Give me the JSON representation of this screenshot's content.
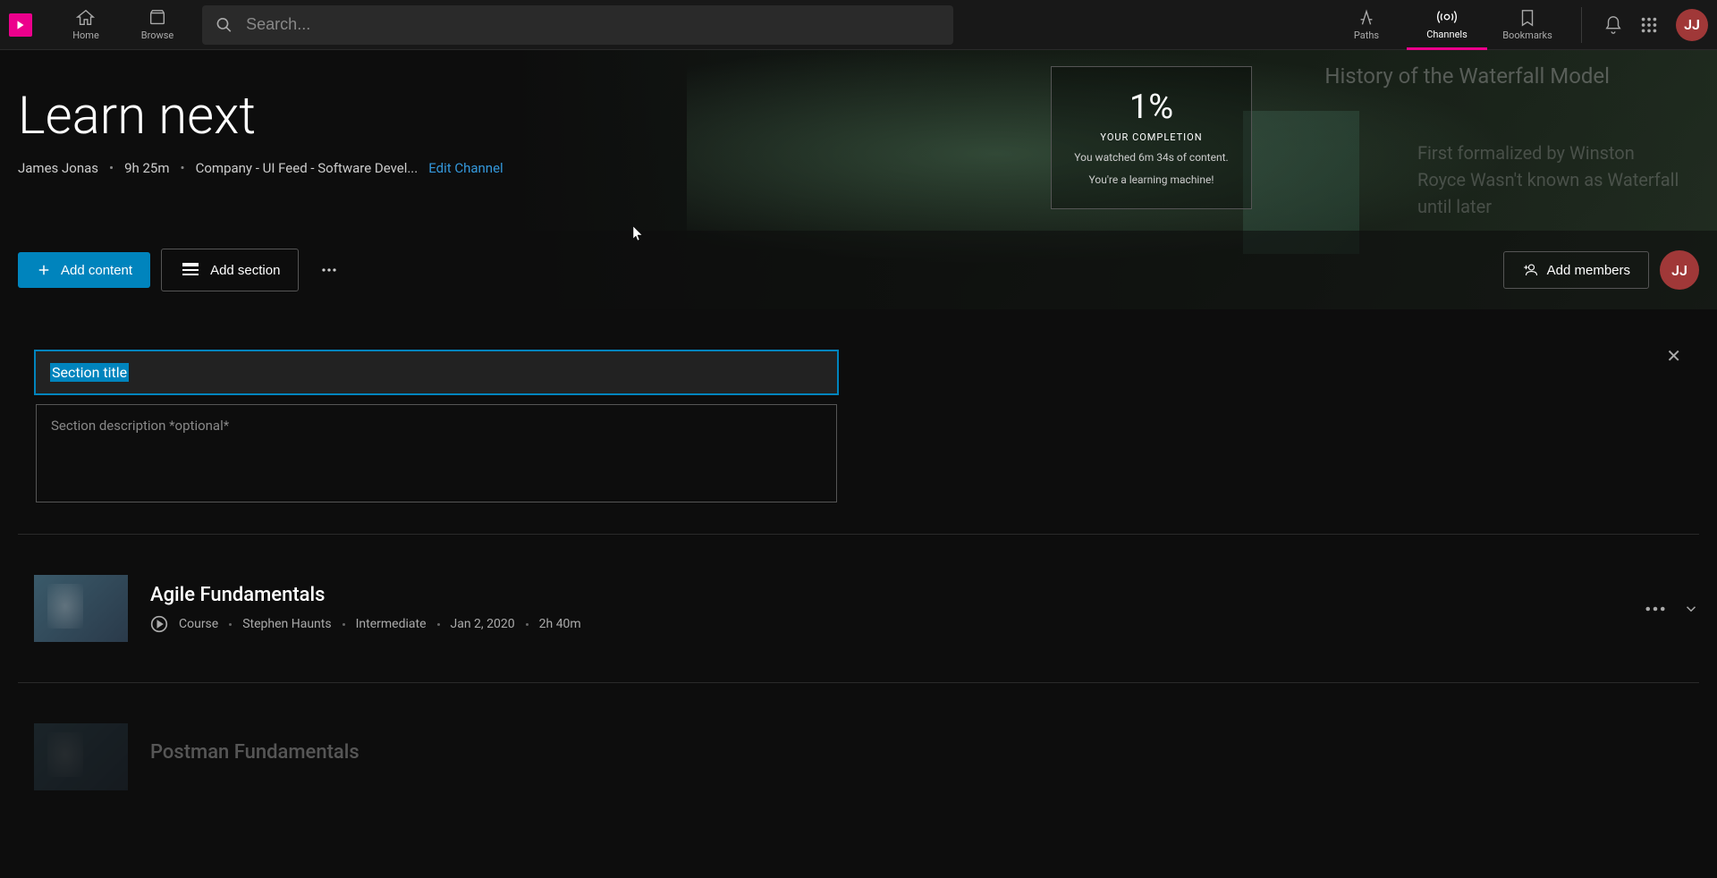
{
  "header": {
    "nav_home": "Home",
    "nav_browse": "Browse",
    "search_placeholder": "Search...",
    "nav_paths": "Paths",
    "nav_channels": "Channels",
    "nav_bookmarks": "Bookmarks",
    "avatar_initials": "JJ"
  },
  "hero": {
    "title": "Learn next",
    "author": "James Jonas",
    "duration": "9h 25m",
    "breadcrumb": "Company - UI Feed - Software Devel...",
    "edit_label": "Edit Channel",
    "bg_title": "History of the Waterfall Model",
    "bg_para": "First formalized by Winston Royce Wasn't known as Waterfall until later"
  },
  "completion": {
    "pct": "1%",
    "label": "YOUR COMPLETION",
    "line1": "You watched 6m 34s of content.",
    "line2": "You're a learning machine!"
  },
  "actions": {
    "add_content": "Add content",
    "add_section": "Add section",
    "add_members": "Add members",
    "avatar_initials": "JJ"
  },
  "section_editor": {
    "title_value": "Section title",
    "desc_placeholder": "Section description *optional*"
  },
  "content_item": {
    "title": "Agile Fundamentals",
    "type": "Course",
    "author": "Stephen Haunts",
    "level": "Intermediate",
    "date": "Jan 2, 2020",
    "duration": "2h 40m"
  },
  "faded_item": {
    "title": "Postman Fundamentals"
  }
}
